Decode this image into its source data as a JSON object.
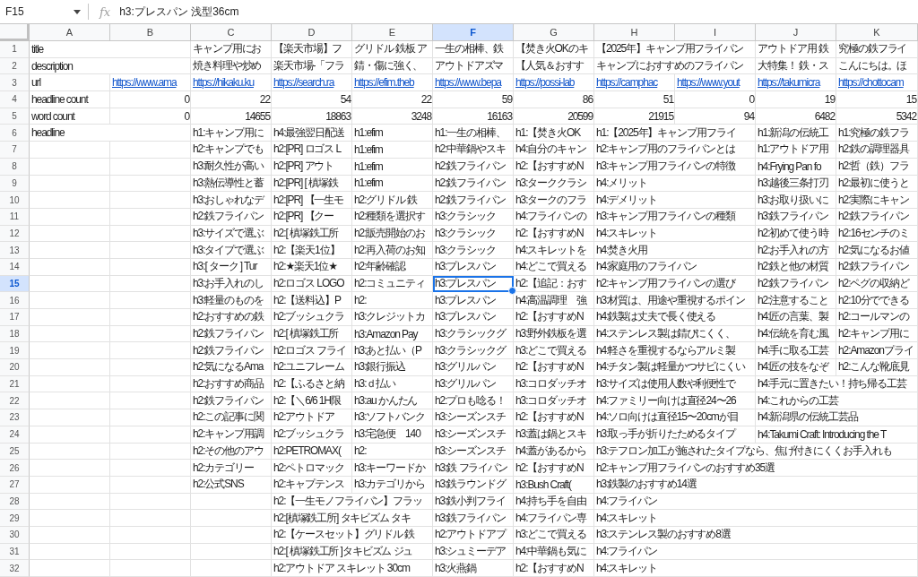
{
  "formula_bar": {
    "cell_ref": "F15",
    "fx_label": "fx",
    "formula": "h3:プレスパン 浅型36cm"
  },
  "columns": [
    {
      "letter": "A",
      "selected": false
    },
    {
      "letter": "B",
      "selected": false
    },
    {
      "letter": "C",
      "selected": false
    },
    {
      "letter": "D",
      "selected": false
    },
    {
      "letter": "E",
      "selected": false
    },
    {
      "letter": "F",
      "selected": true
    },
    {
      "letter": "G",
      "selected": false
    },
    {
      "letter": "H",
      "selected": false
    },
    {
      "letter": "I",
      "selected": false
    },
    {
      "letter": "J",
      "selected": false
    },
    {
      "letter": "K",
      "selected": false
    }
  ],
  "rows": [
    {
      "number": "1",
      "selected": false,
      "kind": "text",
      "cells": [
        "title",
        null,
        "キャンプ用にお",
        "【楽天市場】フ",
        "グリドル 鉄板 ア",
        "一生の相棒、鉄",
        "【焚き火OKのキ",
        "【2025年】キャンプ用フライパン",
        null,
        "アウトドア用 鉄",
        "究極の鉄フライ"
      ]
    },
    {
      "number": "2",
      "selected": false,
      "kind": "text",
      "cells": [
        "description",
        null,
        "焼き料理や炒め",
        "楽天市場-「フラ",
        "錆・傷に強く、",
        "アウトドアズマ",
        "【人気＆おすす",
        "キャンプにおすすめのフライパン",
        null,
        "大特集！ 鉄・ス",
        "こんにちは。ほ"
      ]
    },
    {
      "number": "3",
      "selected": false,
      "kind": "link",
      "cells": [
        "url",
        "https://www.ama",
        "https://hikaku.ku",
        "https://search.ra",
        "https://efim.theb",
        "https://www.bepa",
        "https://possi-lab",
        "https://camphac",
        "https://www.yout",
        "https://takumicra",
        "https://chottocam"
      ]
    },
    {
      "number": "4",
      "selected": false,
      "kind": "number",
      "cells": [
        "headline count",
        "0",
        "22",
        "54",
        "22",
        "59",
        "86",
        "51",
        "0",
        "19",
        "15"
      ]
    },
    {
      "number": "5",
      "selected": false,
      "kind": "number",
      "cells": [
        "word count",
        "0",
        "14655",
        "18863",
        "3248",
        "16163",
        "20599",
        "21915",
        "94",
        "6482",
        "5342"
      ]
    },
    {
      "number": "6",
      "selected": false,
      "kind": "text",
      "cells": [
        "headline",
        null,
        "h1:キャンプ用に",
        "h4:最強翌日配送",
        "h1:efim",
        "h1:一生の相棒、",
        "h1:【焚き火OK",
        "h1:【2025年】キャンプ用フライ",
        null,
        "h1:新潟の伝統工",
        "h1:究極の鉄フラ"
      ]
    },
    {
      "number": "7",
      "selected": false,
      "kind": "text",
      "cells": [
        null,
        null,
        "h2:キャンプでも",
        "h2:[PR] ロゴス L",
        "h1:efim",
        "h2:中華鍋やスキ",
        "h4:自分のキャン",
        "h2:キャンプ用のフライパンとは",
        null,
        "h1:アウトドア用",
        "h2:鉄の調理器具"
      ]
    },
    {
      "number": "8",
      "selected": false,
      "kind": "text",
      "cells": [
        null,
        null,
        "h3:耐久性が高い",
        "h2:[PR] アウト",
        "h1:efim",
        "h2:鉄フライパン",
        "h2:【おすすめN",
        "h3:キャンプ用フライパンの特徴",
        null,
        "h4:Frying Pan fo",
        "h2:哲（鉄）フラ"
      ]
    },
    {
      "number": "9",
      "selected": false,
      "kind": "text",
      "cells": [
        null,
        null,
        "h3:熱伝導性と蓄",
        "h2:[PR] [ 槙塚鉄",
        "h1:efim",
        "h2:鉄フライパン",
        "h3:ターククラシ",
        "h4:メリット",
        null,
        "h3:越後三条打刃",
        "h2:最初に使うと"
      ]
    },
    {
      "number": "10",
      "selected": false,
      "kind": "text",
      "cells": [
        null,
        null,
        "h3:おしゃれなデ",
        "h2:[PR] 【一生モ",
        "h2:グリドル 鉄",
        "h2:鉄フライパン",
        "h3:タークのフラ",
        "h4:デメリット",
        null,
        "h3:お取り扱いに",
        "h2:実際にキャン"
      ]
    },
    {
      "number": "11",
      "selected": false,
      "kind": "text",
      "cells": [
        null,
        null,
        "h2:鉄フライパン",
        "h2:[PR] 【クー",
        "h2:種類を選択す",
        "h3:クラシック",
        "h4:フライパンの",
        "h3:キャンプ用フライパンの種類",
        null,
        "h3:鉄フライパン",
        "h2:鉄フライパン"
      ]
    },
    {
      "number": "12",
      "selected": false,
      "kind": "text",
      "cells": [
        null,
        null,
        "h3:サイズで選ぶ",
        "h2:[ 槙塚鉄工所",
        "h2:販売開始のお",
        "h3:クラシック",
        "h2:【おすすめN",
        "h4:スキレット",
        null,
        "h2:初めて使う時",
        "h2:16センチのミ"
      ]
    },
    {
      "number": "13",
      "selected": false,
      "kind": "text",
      "cells": [
        null,
        null,
        "h3:タイプで選ぶ",
        "h2:【楽天1位】",
        "h2:再入荷のお知",
        "h3:クラシック",
        "h4:スキレットを",
        "h4:焚き火用",
        null,
        "h2:お手入れの方",
        "h2:気になるお値"
      ]
    },
    {
      "number": "14",
      "selected": false,
      "kind": "text",
      "cells": [
        null,
        null,
        "h3:[ ターク ] Tur",
        "h2:★楽天1位★",
        "h2:年齢確認",
        "h3:プレスパン",
        "h4:どこで買える",
        "h4:家庭用のフライパン",
        null,
        "h2:鉄と他の材質",
        "h2:鉄フライパン"
      ]
    },
    {
      "number": "15",
      "selected": true,
      "kind": "text",
      "cells": [
        null,
        null,
        "h3:お手入れのし",
        "h2:ロゴス LOGO",
        "h2:コミュニティ",
        "h3:プレスパン",
        "h2:【追記：おす",
        "h2:キャンプ用フライパンの選び",
        null,
        "h2:鉄フライパン",
        "h2:ペグの収納ど"
      ]
    },
    {
      "number": "16",
      "selected": false,
      "kind": "text",
      "cells": [
        null,
        null,
        "h3:軽量のものを",
        "h2:【送料込】P",
        "h2:",
        "h3:プレスパン",
        "h4:高温調理　強",
        "h3:材質は、用途や重視するポイン",
        null,
        "h2:注意すること",
        "h2:10分でできる"
      ]
    },
    {
      "number": "17",
      "selected": false,
      "kind": "text",
      "cells": [
        null,
        null,
        "h2:おすすめの鉄",
        "h2:ブッシュクラ",
        "h3:クレジットカ",
        "h3:プレスパン",
        "h2:【おすすめN",
        "h4:鉄製は丈夫で長く使える",
        null,
        "h4:匠の言葉、製",
        "h2:コールマンの"
      ]
    },
    {
      "number": "18",
      "selected": false,
      "kind": "text",
      "cells": [
        null,
        null,
        "h2:鉄フライパン",
        "h2:[ 槙塚鉄工所",
        "h3:Amazon Pay",
        "h3:クラシックグ",
        "h3:野外鉄板を選",
        "h4:ステンレス製は錆びにくく、",
        null,
        "h4:伝統を育む風",
        "h2:キャンプ用に"
      ]
    },
    {
      "number": "19",
      "selected": false,
      "kind": "text",
      "cells": [
        null,
        null,
        "h2:鉄フライパン",
        "h2:ロゴス フライ",
        "h3:あと払い（P",
        "h3:クラシックグ",
        "h3:どこで買える",
        "h4:軽さを重視するならアルミ製",
        null,
        "h4:手に取る工芸",
        "h2:Amazonプライ"
      ]
    },
    {
      "number": "20",
      "selected": false,
      "kind": "text",
      "cells": [
        null,
        null,
        "h2:気になるAma",
        "h2:ユニフレーム",
        "h3:銀行振込",
        "h3:グリルパン",
        "h2:【おすすめN",
        "h4:チタン製は軽量かつサビにくい",
        null,
        "h4:匠の技をなぞ",
        "h2:こんな靴底見"
      ]
    },
    {
      "number": "21",
      "selected": false,
      "kind": "text",
      "cells": [
        null,
        null,
        "h2:おすすめ商品",
        "h2:【ふるさと納",
        "h3:ｄ払い",
        "h3:グリルパン",
        "h3:コロダッチオ",
        "h3:サイズは使用人数や利便性で",
        null,
        "h4:手元に置きたい！持ち帰る工芸",
        null
      ]
    },
    {
      "number": "22",
      "selected": false,
      "kind": "text",
      "cells": [
        null,
        null,
        "h2:鉄フライパン",
        "h2:【＼6/6 1H限",
        "h3:au かんたん",
        "h2:プロも唸る！",
        "h3:コロダッチオ",
        "h4:ファミリー向けは直径24〜26",
        null,
        "h4:これからの工芸",
        null
      ]
    },
    {
      "number": "23",
      "selected": false,
      "kind": "text",
      "cells": [
        null,
        null,
        "h2:この記事に関",
        "h2:アウトドア",
        "h3:ソフトバンク",
        "h3:シーズンスチ",
        "h2:【おすすめN",
        "h4:ソロ向けは直径15〜20cmが目",
        null,
        "h4:新潟県の伝統工芸品",
        null
      ]
    },
    {
      "number": "24",
      "selected": false,
      "kind": "text",
      "cells": [
        null,
        null,
        "h2:キャンプ用調",
        "h2:ブッシュクラ",
        "h3:宅急便　140",
        "h3:シーズンスチ",
        "h3:蓋は鍋とスキ",
        "h3:取っ手が折りたためるタイプ",
        null,
        "h4:Takumi Craft: Introducing the T",
        null
      ]
    },
    {
      "number": "25",
      "selected": false,
      "kind": "text",
      "cells": [
        null,
        null,
        "h2:その他のアウ",
        "h2:PETROMAX(",
        "h2:",
        "h3:シーズンスチ",
        "h4:蓋があるから",
        "h3:テフロン加工が施されたタイプなら、焦げ付きにくくお手入れも",
        null,
        null,
        null
      ]
    },
    {
      "number": "26",
      "selected": false,
      "kind": "text",
      "cells": [
        null,
        null,
        "h2:カテゴリー",
        "h2:ペトロマック",
        "h3:キーワードか",
        "h3:鉄 フライパン",
        "h2:【おすすめN",
        "h2:キャンプ用フライパンのおすすめ35選",
        null,
        null,
        null
      ]
    },
    {
      "number": "27",
      "selected": false,
      "kind": "text",
      "cells": [
        null,
        null,
        "h2:公式SNS",
        "h2:キャプテンス",
        "h3:カテゴリから",
        "h3:鉄ラウンドグ",
        "h3:Bush Craft(",
        "h3:鉄製のおすすめ14選",
        null,
        null,
        null
      ]
    },
    {
      "number": "28",
      "selected": false,
      "kind": "text",
      "cells": [
        null,
        null,
        null,
        "h2:【一生モノフライパン】フラッ",
        null,
        "h3:鉄小判フライ",
        "h4:持ち手を自由",
        "h4:フライパン",
        null,
        null,
        null
      ]
    },
    {
      "number": "29",
      "selected": false,
      "kind": "text",
      "cells": [
        null,
        null,
        null,
        "h2:[槙塚鉄工所] タキビズム タキ",
        null,
        "h3:鉄フライパン",
        "h4:フライパン専",
        "h4:スキレット",
        null,
        null,
        null
      ]
    },
    {
      "number": "30",
      "selected": false,
      "kind": "text",
      "cells": [
        null,
        null,
        null,
        "h2:【ケースセット】グリドル 鉄",
        null,
        "h2:アウトドアプ",
        "h3:どこで買える",
        "h3:ステンレス製のおすすめ8選",
        null,
        null,
        null
      ]
    },
    {
      "number": "31",
      "selected": false,
      "kind": "text",
      "cells": [
        null,
        null,
        null,
        "h2:[ 槙塚鉄工所 ]タキビズム ジュ",
        null,
        "h3:シュミーデア",
        "h4:中華鍋も気に",
        "h4:フライパン",
        null,
        null,
        null
      ]
    },
    {
      "number": "32",
      "selected": false,
      "kind": "text",
      "cells": [
        null,
        null,
        null,
        "h2:アウトドア スキレット 30cm",
        null,
        "h3:火燕鍋",
        "h2:【おすすめN",
        "h4:スキレット",
        null,
        null,
        null
      ]
    }
  ]
}
